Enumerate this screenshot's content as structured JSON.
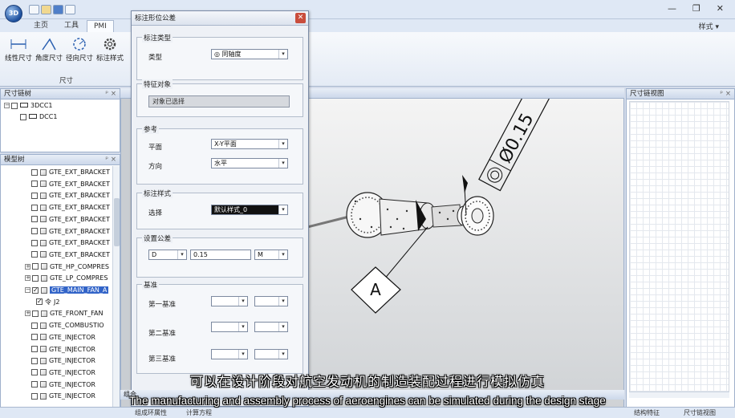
{
  "app": {
    "logo_text": "3D"
  },
  "window": {
    "minimize": "—",
    "restore": "❐",
    "close": "✕"
  },
  "tabs": [
    {
      "label": "主页"
    },
    {
      "label": "工具"
    },
    {
      "label": "PMI"
    }
  ],
  "style_menu": "样式 ▾",
  "ribbon": {
    "buttons": [
      {
        "label": "线性尺寸",
        "icon": "linear-dimension-icon"
      },
      {
        "label": "角度尺寸",
        "icon": "angle-dimension-icon"
      },
      {
        "label": "径向尺寸",
        "icon": "radial-dimension-icon"
      },
      {
        "label": "标注样式",
        "icon": "gear-icon"
      }
    ],
    "group_label": "尺寸"
  },
  "dim_panel": {
    "title": "尺寸链树",
    "items": [
      {
        "label": "3DCC1"
      },
      {
        "label": "DCC1"
      }
    ]
  },
  "model_panel": {
    "title": "模型树",
    "items": [
      {
        "label": "GTE_EXT_BRACKET"
      },
      {
        "label": "GTE_EXT_BRACKET"
      },
      {
        "label": "GTE_EXT_BRACKET"
      },
      {
        "label": "GTE_EXT_BRACKET"
      },
      {
        "label": "GTE_EXT_BRACKET"
      },
      {
        "label": "GTE_EXT_BRACKET"
      },
      {
        "label": "GTE_EXT_BRACKET"
      },
      {
        "label": "GTE_EXT_BRACKET"
      },
      {
        "label": "GTE_HP_COMPRES"
      },
      {
        "label": "GTE_LP_COMPRES"
      },
      {
        "label": "GTE_MAIN_FAN_A"
      },
      {
        "label": "J2"
      },
      {
        "label": "GTE_FRONT_FAN"
      },
      {
        "label": "GTE_COMBUSTIO"
      },
      {
        "label": "GTE_INJECTOR"
      },
      {
        "label": "GTE_INJECTOR"
      },
      {
        "label": "GTE_INJECTOR"
      },
      {
        "label": "GTE_INJECTOR"
      },
      {
        "label": "GTE_INJECTOR"
      },
      {
        "label": "GTE_INJECTOR"
      }
    ]
  },
  "dialog": {
    "title": "标注形位公差",
    "close": "✕",
    "type_group": {
      "title": "标注类型",
      "label": "类型",
      "value": "同轴度"
    },
    "feature_group": {
      "title": "特征对象",
      "button": "对象已选择"
    },
    "ref_group": {
      "title": "参考",
      "plane_label": "平面",
      "plane_value": "X-Y平面",
      "dir_label": "方向",
      "dir_value": "水平"
    },
    "style_group": {
      "title": "标注样式",
      "label": "选择",
      "value": "默认样式_0"
    },
    "tol_group": {
      "title": "设置公差",
      "symbol": "D",
      "value": "0.15",
      "modifier": "M"
    },
    "datum_group": {
      "title": "基准",
      "first": "第一基准",
      "second": "第二基准",
      "third": "第三基准"
    }
  },
  "viewport": {
    "tolerance_text": "Ø0.15",
    "datum_letter": "A"
  },
  "right_panel": {
    "title": "尺寸链视图"
  },
  "bottom": {
    "panel_title": "组合",
    "left_items": "组成环属性",
    "left_items2": "计算方程",
    "right_items": "结构特征",
    "right_items2": "尺寸链视图"
  },
  "subtitles": {
    "cn": "可以在设计阶段对航空发动机的制造装配过程进行模拟仿真",
    "en": "The manufacturing and assembly process of aeroengines can be simulated during the design stage"
  },
  "colors": {
    "selection": "#3264c8",
    "ribbon": "#dfe8f5"
  }
}
